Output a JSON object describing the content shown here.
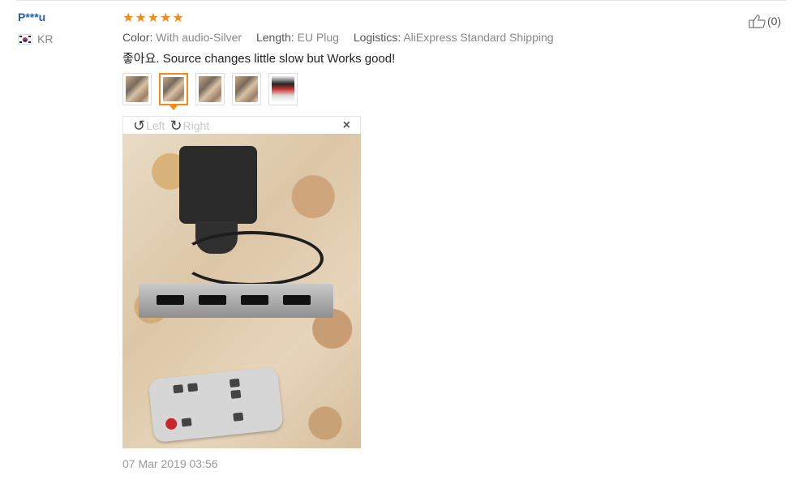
{
  "user": {
    "name": "P***u",
    "country": "KR"
  },
  "review": {
    "rating": 5,
    "attributes": [
      {
        "key": "Color:",
        "value": "With audio-Silver"
      },
      {
        "key": "Length:",
        "value": "EU Plug"
      },
      {
        "key": "Logistics:",
        "value": "AliExpress Standard Shipping"
      }
    ],
    "comment": "좋아요. Source changes little slow but Works good!",
    "thumbnail_count": 5,
    "active_thumbnail": 2,
    "date": "07 Mar 2019 03:56"
  },
  "viewer": {
    "rotate_left_label": "Left",
    "rotate_right_label": "Right",
    "close_label": "×"
  },
  "helpful": {
    "count_label": "(0)"
  },
  "colors": {
    "star": "#f28a1c",
    "username": "#2a5db0",
    "active_border": "#f28a1c"
  }
}
